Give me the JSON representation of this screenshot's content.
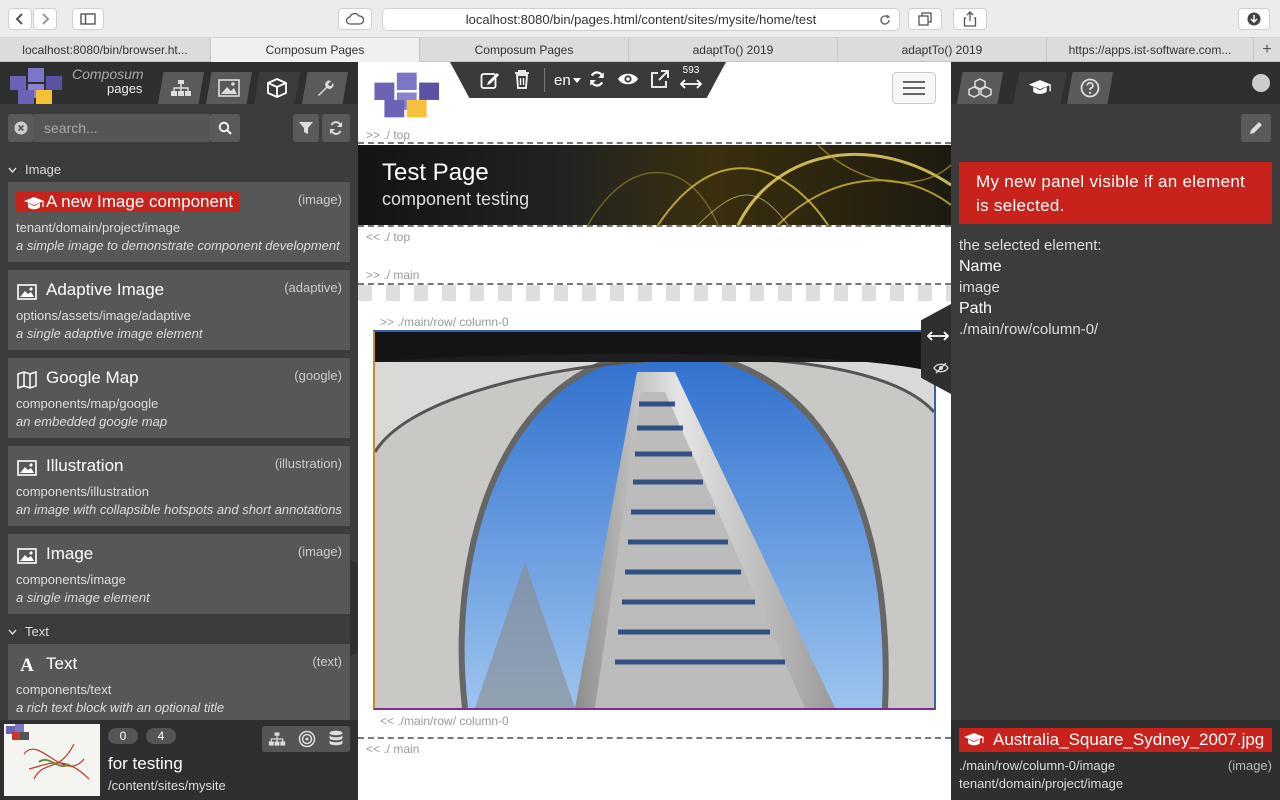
{
  "browser": {
    "url": "localhost:8080/bin/pages.html/content/sites/mysite/home/test",
    "tabs": [
      {
        "label": "localhost:8080/bin/browser.ht...",
        "active": false
      },
      {
        "label": "Composum Pages",
        "active": true
      },
      {
        "label": "Composum Pages",
        "active": false
      },
      {
        "label": "adaptTo() 2019",
        "active": false
      },
      {
        "label": "adaptTo() 2019",
        "active": false
      },
      {
        "label": "https://apps.ist-software.com...",
        "active": false
      }
    ],
    "new_tab": "+"
  },
  "left": {
    "logo_line1": "Composum",
    "logo_line2": "pages",
    "search": {
      "placeholder": "search..."
    },
    "groups": [
      {
        "label": "Image"
      },
      {
        "label": "Text"
      }
    ],
    "components": [
      {
        "title": "A new Image component",
        "type": "(image)",
        "path": "tenant/domain/project/image",
        "desc": "a simple image to demonstrate component development",
        "icon": "graduation-cap-icon",
        "selected": true
      },
      {
        "title": "Adaptive Image",
        "type": "(adaptive)",
        "path": "options/assets/image/adaptive",
        "desc": "a single adaptive image element",
        "icon": "image-icon"
      },
      {
        "title": "Google Map",
        "type": "(google)",
        "path": "components/map/google",
        "desc": "an embedded google map",
        "icon": "map-icon"
      },
      {
        "title": "Illustration",
        "type": "(illustration)",
        "path": "components/illustration",
        "desc": "an image with collapsible hotspots and short annotations",
        "icon": "image-icon"
      },
      {
        "title": "Image",
        "type": "(image)",
        "path": "components/image",
        "desc": "a single image element",
        "icon": "image-icon"
      },
      {
        "title": "Text",
        "type": "(text)",
        "path": "components/text",
        "desc": "a rich text block with an optional title",
        "icon": "font-icon"
      }
    ],
    "footer": {
      "badge1": "0",
      "badge2": "4",
      "site_title": "for testing",
      "site_path": "/content/sites/mysite"
    }
  },
  "center": {
    "lang": "en",
    "width_value": "593",
    "crumbs": {
      "top_open": ">> ./ top",
      "top_close": "<< ./ top",
      "main_open": ">> ./ main",
      "col_open": ">> ./main/row/ column-0",
      "col_close": "<< ./main/row/ column-0",
      "main_close": "<< ./ main"
    },
    "hero": {
      "title": "Test Page",
      "subtitle": "component testing"
    }
  },
  "right": {
    "alert": "My new panel visible if an element is selected.",
    "selected_label": "the selected element:",
    "name_label": "Name",
    "name_value": "image",
    "path_label": "Path",
    "path_value": "./main/row/column-0/",
    "footer": {
      "file": "Australia_Square_Sydney_2007.jpg",
      "path": "./main/row/column-0/image",
      "type": "(image)",
      "resource": "tenant/domain/project/image"
    }
  },
  "colors": {
    "accent": "#c8221d",
    "panel": "#3c3c3c",
    "panel_dark": "#2f2f2f",
    "item": "#575757"
  }
}
